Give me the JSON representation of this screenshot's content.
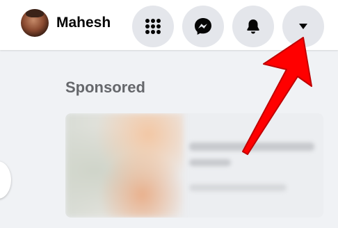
{
  "header": {
    "profile_name": "Mahesh",
    "buttons": [
      {
        "name": "menu",
        "icon": "grid-icon"
      },
      {
        "name": "messenger",
        "icon": "messenger-icon"
      },
      {
        "name": "notifications",
        "icon": "bell-icon"
      },
      {
        "name": "account",
        "icon": "caret-down-icon"
      }
    ]
  },
  "feed": {
    "sponsored_heading": "Sponsored"
  },
  "annotation": {
    "icon": "red-arrow",
    "color": "#ff0000"
  },
  "colors": {
    "topbar_bg": "#ffffff",
    "page_bg": "#f0f2f5",
    "button_bg": "#e4e6eb",
    "heading_gray": "#65676b"
  }
}
